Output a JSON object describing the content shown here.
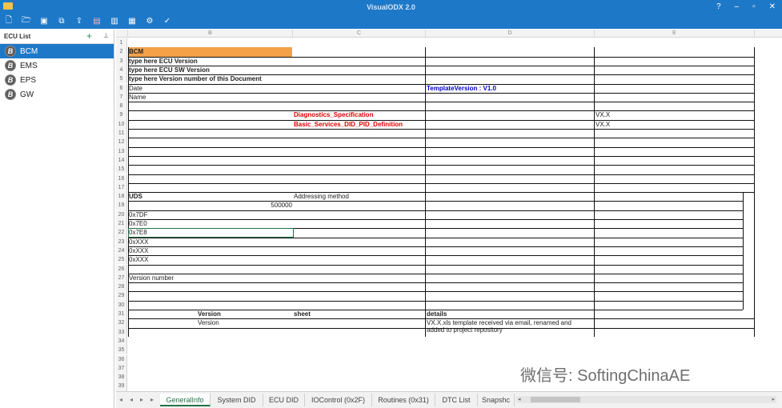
{
  "app": {
    "title": "VisualODX 2.0",
    "accent": "#1e78c8",
    "window_controls": [
      "?",
      "–",
      "▫",
      "✕"
    ]
  },
  "toolbar": {
    "icons": [
      "new-file-icon",
      "open-folder-icon",
      "save-icon",
      "save-all-icon",
      "export-icon",
      "pdf-icon",
      "report-icon",
      "chart-icon",
      "settings-icon",
      "validate-icon"
    ]
  },
  "sidebar": {
    "title": "ECU List",
    "add": "+",
    "pin": "📌",
    "items": [
      {
        "badge": "B",
        "label": "BCM"
      },
      {
        "badge": "B",
        "label": "EMS"
      },
      {
        "badge": "B",
        "label": "EPS"
      },
      {
        "badge": "B",
        "label": "GW"
      }
    ]
  },
  "grid": {
    "columns": [
      "B",
      "C",
      "D",
      "E"
    ],
    "rows": [
      {
        "n": "1"
      },
      {
        "n": "2",
        "b": "BCM"
      },
      {
        "n": "3",
        "b": "type here ECU Version"
      },
      {
        "n": "4",
        "b": "type here ECU SW Version"
      },
      {
        "n": "5",
        "b": "type here Version number of this Document"
      },
      {
        "n": "6",
        "b": "Date",
        "d": "TemplateVersion : V1.0"
      },
      {
        "n": "7",
        "b": "Name"
      },
      {
        "n": "8"
      },
      {
        "n": "9",
        "c": "Diagnostics_Specification",
        "e": "VX.X"
      },
      {
        "n": "10",
        "c": "Basic_Services_DID_PID_Definition",
        "e": "VX.X"
      },
      {
        "n": "11"
      },
      {
        "n": "12"
      },
      {
        "n": "13"
      },
      {
        "n": "14"
      },
      {
        "n": "15"
      },
      {
        "n": "16"
      },
      {
        "n": "17"
      },
      {
        "n": "18",
        "b": "UDS",
        "c": "Addressing method"
      },
      {
        "n": "19",
        "b": "500000"
      },
      {
        "n": "20",
        "b": "0x7DF"
      },
      {
        "n": "21",
        "b": "0x7E0"
      },
      {
        "n": "22",
        "b": "0x7E8"
      },
      {
        "n": "23",
        "b": "0xXXX"
      },
      {
        "n": "24",
        "b": "0xXXX"
      },
      {
        "n": "25",
        "b": "0xXXX"
      },
      {
        "n": "26"
      },
      {
        "n": "27",
        "b": "Version number"
      },
      {
        "n": "28"
      },
      {
        "n": "29"
      },
      {
        "n": "30"
      },
      {
        "n": "31",
        "b": "Version",
        "c": "sheet",
        "d": "details"
      },
      {
        "n": "32",
        "b": "Version",
        "d": "VX.X.xls template received  via email, renamed and",
        "d2": "added to project repository"
      },
      {
        "n": "33"
      },
      {
        "n": "34"
      },
      {
        "n": "35"
      },
      {
        "n": "36"
      },
      {
        "n": "37"
      },
      {
        "n": "38"
      },
      {
        "n": "39"
      }
    ]
  },
  "watermark": "微信号: SoftingChinaAE",
  "tabs": {
    "nav": [
      "◂",
      "◂",
      "▸",
      "▸"
    ],
    "items": [
      {
        "label": "GeneralInfo",
        "active": true
      },
      {
        "label": "System DID"
      },
      {
        "label": "ECU DID"
      },
      {
        "label": "IOControl (0x2F)"
      },
      {
        "label": "Routines (0x31)"
      },
      {
        "label": "DTC List"
      },
      {
        "label": "Snapshc"
      }
    ],
    "scroll_left": "◂",
    "scroll_right": "▸"
  }
}
